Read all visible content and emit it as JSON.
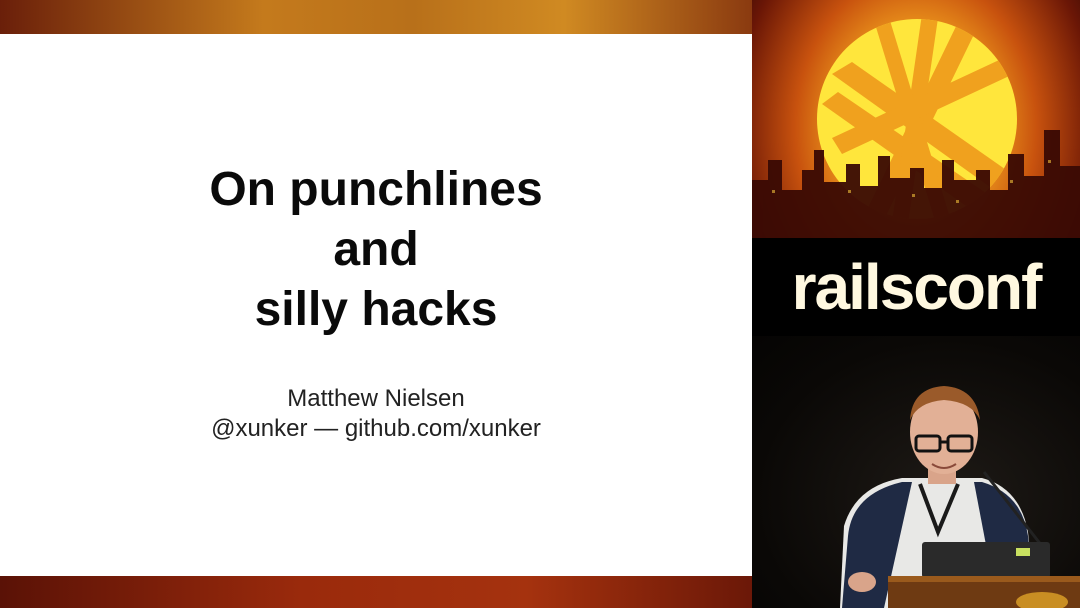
{
  "slide": {
    "title_lines": [
      "On punchlines",
      "and",
      "silly hacks"
    ],
    "speaker_name": "Matthew Nielsen",
    "speaker_handles": "@xunker — github.com/xunker"
  },
  "branding": {
    "wordmark": "railsconf",
    "logo": "sun-with-rails-logo",
    "colors": {
      "sun": "#ffe14a",
      "glow": "#f4a620",
      "deep_red": "#6a1606"
    }
  },
  "video": {
    "scene": "presenter-at-podium"
  }
}
